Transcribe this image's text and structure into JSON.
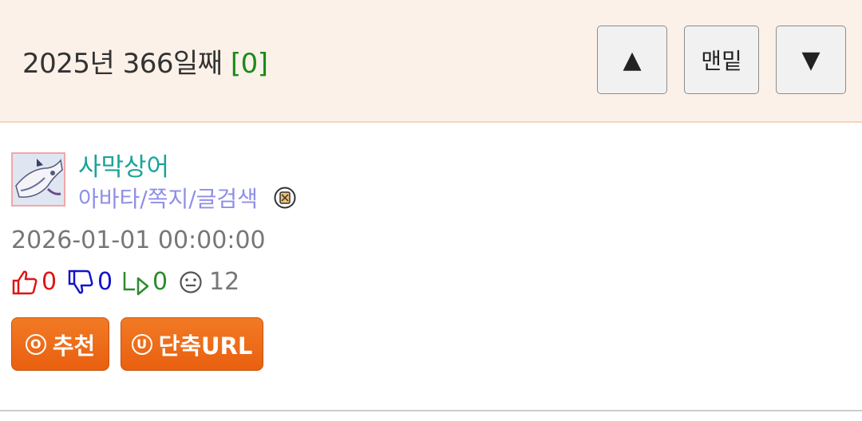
{
  "header": {
    "title": "2025년 366일째",
    "count": "[0]",
    "up_label": "▲",
    "bottom_label": "맨밑",
    "down_label": "▼"
  },
  "post": {
    "author": "사막상어",
    "author_links": "아바타/쪽지/글검색",
    "date": "2026-01-01 00:00:00",
    "upvotes": "0",
    "downvotes": "0",
    "replies": "0",
    "views": "12"
  },
  "buttons": {
    "recommend_icon": "O",
    "recommend_label": "추천",
    "shorturl_icon": "U",
    "shorturl_label": "단축URL"
  },
  "colors": {
    "header_bg": "#fcf1e8",
    "nick": "#1aa39a",
    "links": "#8f8fe8",
    "upvote": "#e01414",
    "downvote": "#1414c8",
    "reply": "#2e8a2e",
    "button": "#ee6c18"
  },
  "icons": [
    "thumbs-up-icon",
    "thumbs-down-icon",
    "reply-icon",
    "views-face-icon",
    "badge-icon"
  ]
}
